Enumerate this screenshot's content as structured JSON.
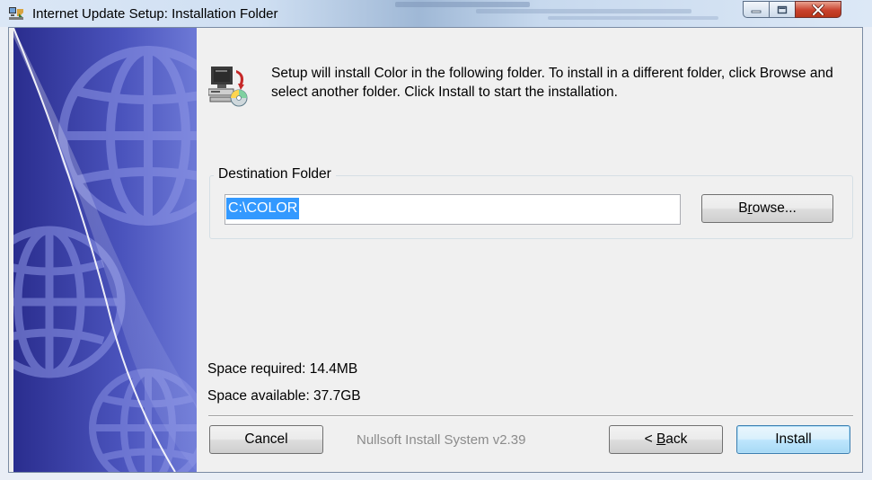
{
  "window": {
    "title": "Internet Update Setup: Installation Folder"
  },
  "intro_text": "Setup will install Color in the following folder. To install in a different folder, click Browse and select another folder. Click Install to start the installation.",
  "destination": {
    "group_label": "Destination Folder",
    "path_value": "C:\\COLOR",
    "browse_label_pre": "B",
    "browse_label_accel": "r",
    "browse_label_post": "owse..."
  },
  "space": {
    "required": "Space required: 14.4MB",
    "available": "Space available: 37.7GB"
  },
  "branding": "Nullsoft Install System v2.39",
  "buttons": {
    "cancel": "Cancel",
    "back_pre": "< ",
    "back_accel": "B",
    "back_post": "ack",
    "install": "Install"
  },
  "colors": {
    "selection": "#3399ff",
    "banner_dark": "#2a2d8e",
    "banner_light": "#6d79d6",
    "close_button": "#c9422d"
  },
  "icons": {
    "app": "installer-icon",
    "setup": "computer-cd-icon",
    "minimize": "minimize-icon",
    "maximize": "maximize-icon",
    "close": "close-icon",
    "banner": "globe-icon"
  }
}
